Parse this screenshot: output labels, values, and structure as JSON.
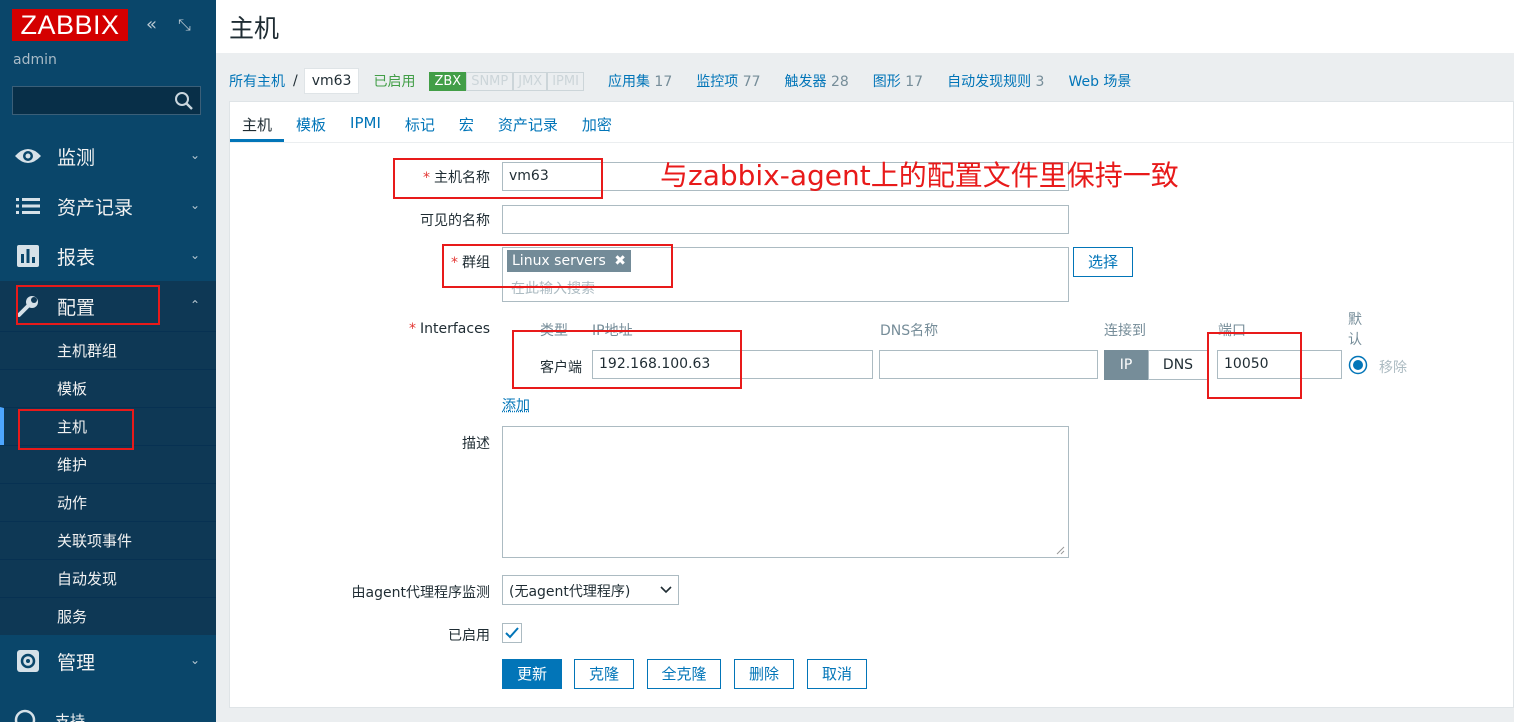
{
  "sidebar": {
    "logo": "ZABBIX",
    "collapse_icon": "«",
    "expand_icon": "⤡",
    "username": "admin",
    "search_placeholder": "",
    "menus": [
      {
        "label": "监测",
        "icon": "eye-icon"
      },
      {
        "label": "资产记录",
        "icon": "list-icon"
      },
      {
        "label": "报表",
        "icon": "bar-chart-icon"
      },
      {
        "label": "配置",
        "icon": "wrench-icon"
      },
      {
        "label": "管理",
        "icon": "gear-icon"
      }
    ],
    "submenu": [
      "主机群组",
      "模板",
      "主机",
      "维护",
      "动作",
      "关联项事件",
      "自动发现",
      "服务"
    ],
    "bottom_partial": "支持"
  },
  "page": {
    "title": "主机"
  },
  "navbar": {
    "all_hosts": "所有主机",
    "sep": "/",
    "host": "vm63",
    "status": "已启用",
    "badges": [
      "ZBX",
      "SNMP",
      "JMX",
      "IPMI"
    ],
    "links": [
      {
        "label": "应用集",
        "count": "17"
      },
      {
        "label": "监控项",
        "count": "77"
      },
      {
        "label": "触发器",
        "count": "28"
      },
      {
        "label": "图形",
        "count": "17"
      },
      {
        "label": "自动发现规则",
        "count": "3"
      },
      {
        "label": "Web 场景",
        "count": ""
      }
    ]
  },
  "tabs": [
    "主机",
    "模板",
    "IPMI",
    "标记",
    "宏",
    "资产记录",
    "加密"
  ],
  "form": {
    "host_name_label": "主机名称",
    "host_name_value": "vm63",
    "visible_name_label": "可见的名称",
    "visible_name_value": "",
    "groups_label": "群组",
    "group_tag": "Linux servers",
    "group_tag_remove": "✖",
    "groups_placeholder": "在此输入搜索",
    "select_button": "选择",
    "interfaces_label": "Interfaces",
    "iface_headers": {
      "type": "类型",
      "ip": "IP地址",
      "dns": "DNS名称",
      "connect": "连接到",
      "port": "端口",
      "default": "默认"
    },
    "iface_row": {
      "type": "客户端",
      "ip": "192.168.100.63",
      "dns": "",
      "connect_ip": "IP",
      "connect_dns": "DNS",
      "port": "10050",
      "remove": "移除"
    },
    "add_link": "添加",
    "description_label": "描述",
    "description_value": "",
    "proxy_label": "由agent代理程序监测",
    "proxy_value": "(无agent代理程序)",
    "enabled_label": "已启用",
    "enabled": true,
    "buttons": {
      "update": "更新",
      "clone": "克隆",
      "full_clone": "全克隆",
      "delete": "删除",
      "cancel": "取消"
    }
  },
  "annotation": "与zabbix-agent上的配置文件里保持一致",
  "colors": {
    "sidebar": "#0a466a",
    "accent": "#0275b8",
    "annotation": "#e81a1a",
    "zbx": "#429e47"
  }
}
